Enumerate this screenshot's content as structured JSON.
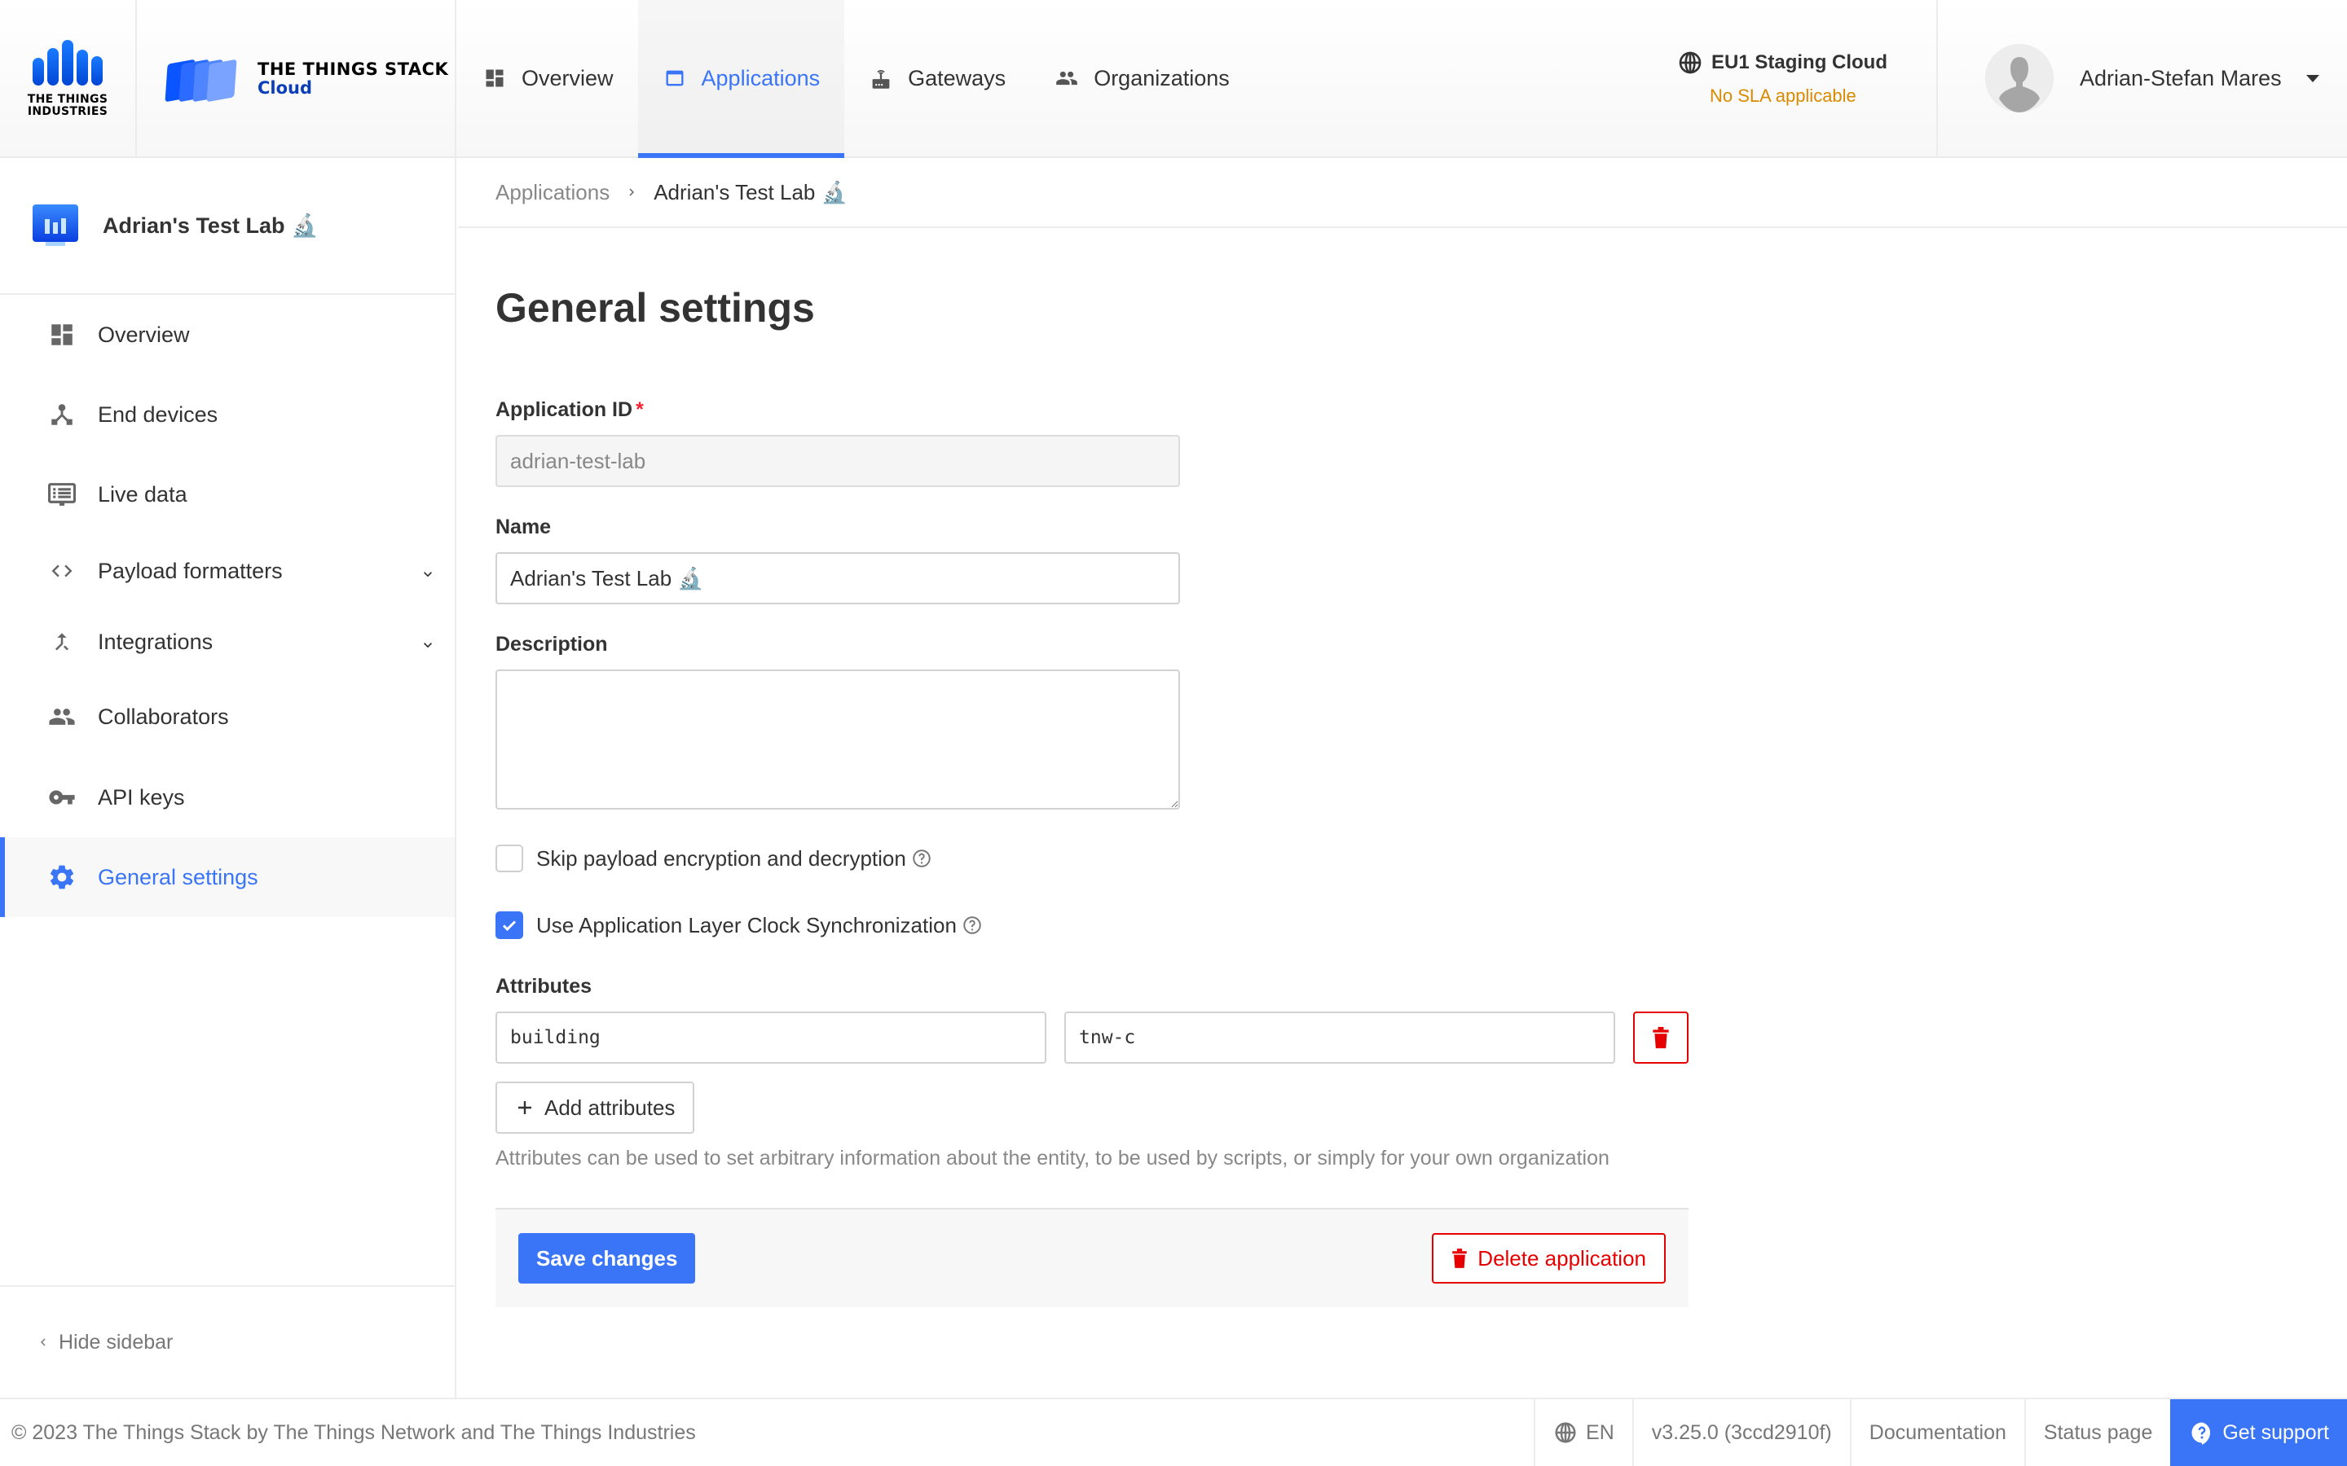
{
  "header": {
    "tti_logo_text": "THE THINGS INDUSTRIES",
    "tts_logo_title": "THE THINGS STACK",
    "tts_logo_sub": "Cloud",
    "nav": [
      {
        "label": "Overview",
        "icon": "dashboard-icon",
        "active": false
      },
      {
        "label": "Applications",
        "icon": "application-window-icon",
        "active": true
      },
      {
        "label": "Gateways",
        "icon": "gateway-router-icon",
        "active": false
      },
      {
        "label": "Organizations",
        "icon": "people-icon",
        "active": false
      }
    ],
    "cluster_name": "EU1 Staging Cloud",
    "cluster_sla": "No SLA applicable",
    "user_name": "Adrian-Stefan Mares"
  },
  "sidebar": {
    "app_title": "Adrian's Test Lab 🔬",
    "items": [
      {
        "label": "Overview",
        "icon": "dashboard-icon"
      },
      {
        "label": "End devices",
        "icon": "device-hub-icon"
      },
      {
        "label": "Live data",
        "icon": "live-data-monitor-icon"
      },
      {
        "label": "Payload formatters",
        "icon": "code-icon",
        "expandable": true
      },
      {
        "label": "Integrations",
        "icon": "merge-icon",
        "expandable": true
      },
      {
        "label": "Collaborators",
        "icon": "people-icon"
      },
      {
        "label": "API keys",
        "icon": "key-icon"
      },
      {
        "label": "General settings",
        "icon": "gear-icon",
        "active": true
      }
    ],
    "hide_label": "Hide sidebar"
  },
  "breadcrumb": {
    "parent": "Applications",
    "current": "Adrian's Test Lab 🔬"
  },
  "form": {
    "title": "General settings",
    "app_id_label": "Application ID",
    "app_id_required": "*",
    "app_id_value": "adrian-test-lab",
    "name_label": "Name",
    "name_value": "Adrian's Test Lab 🔬",
    "description_label": "Description",
    "description_value": "",
    "skip_encryption_label": "Skip payload encryption and decryption",
    "skip_encryption_checked": false,
    "clock_sync_label": "Use Application Layer Clock Synchronization",
    "clock_sync_checked": true,
    "attributes_label": "Attributes",
    "attributes": [
      {
        "key": "building",
        "value": "tnw-c"
      }
    ],
    "add_attributes_label": "Add attributes",
    "attributes_hint": "Attributes can be used to set arbitrary information about the entity, to be used by scripts, or simply for your own organization",
    "save_label": "Save changes",
    "delete_label": "Delete application"
  },
  "footer": {
    "copyright": "© 2023 The Things Stack by The Things Network and The Things Industries",
    "language": "EN",
    "version": "v3.25.0 (3ccd2910f)",
    "documentation": "Documentation",
    "status_page": "Status page",
    "support": "Get support"
  },
  "colors": {
    "accent": "#3a75f7",
    "danger": "#e60000",
    "sla_warning": "#d98a00"
  }
}
